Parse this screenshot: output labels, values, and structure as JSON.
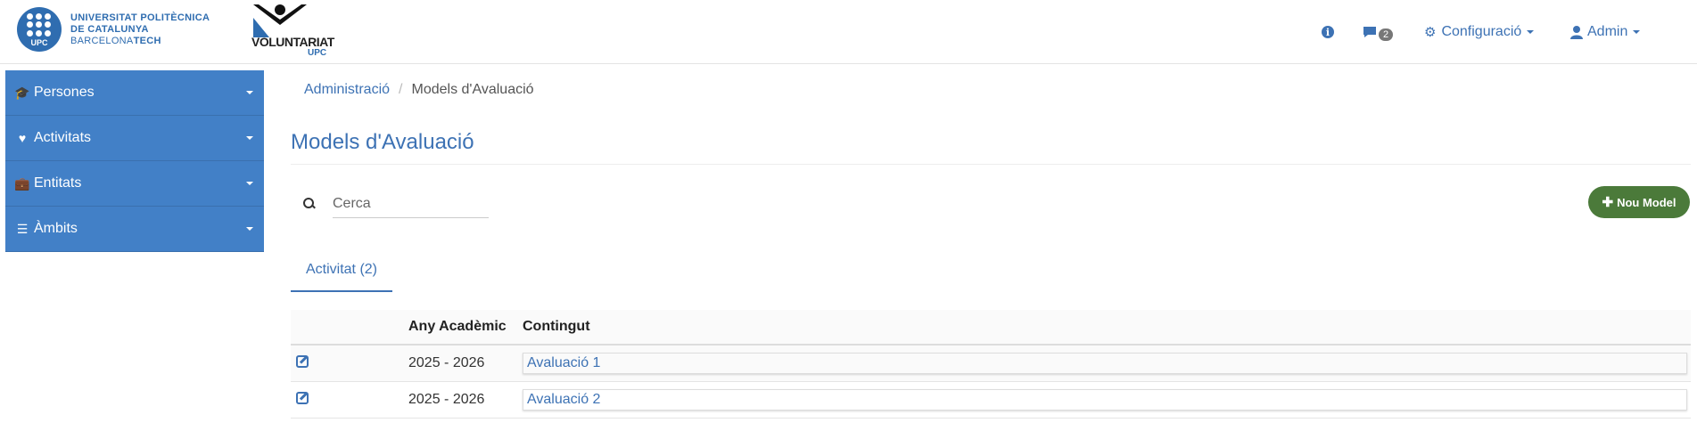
{
  "header": {
    "upc_logo": {
      "circle_text": "UPC",
      "line1": "UNIVERSITAT POLITÈCNICA",
      "line2": "DE CATALUNYA",
      "line3_light": "BARCELONA",
      "line3_bold": "TECH"
    },
    "voluntariat_logo": {
      "title": "VOLUNTARIAT",
      "subtitle": "UPC"
    },
    "info_icon": "i",
    "messages_count": "2",
    "config_label": "Configuració",
    "admin_label": "Admin"
  },
  "sidebar": {
    "items": [
      {
        "label": "Persones",
        "icon": "graduation-cap-icon",
        "glyph": "🎓"
      },
      {
        "label": "Activitats",
        "icon": "heart-icon",
        "glyph": "♥"
      },
      {
        "label": "Entitats",
        "icon": "briefcase-icon",
        "glyph": "💼"
      },
      {
        "label": "Àmbits",
        "icon": "list-icon",
        "glyph": "☰"
      }
    ]
  },
  "breadcrumb": {
    "parent": "Administració",
    "separator": "/",
    "current": "Models d'Avaluació"
  },
  "page_title": "Models d'Avaluació",
  "search": {
    "placeholder": "Cerca",
    "value": ""
  },
  "new_button_label": "Nou Model",
  "tabs": [
    {
      "label": "Activitat (2)",
      "active": true
    }
  ],
  "table": {
    "headers": [
      "",
      "Any Acadèmic",
      "Contingut"
    ],
    "rows": [
      {
        "year": "2025 - 2026",
        "content": "Avaluació 1"
      },
      {
        "year": "2025 - 2026",
        "content": "Avaluació 2"
      }
    ]
  },
  "colors": {
    "primary": "#3d72b4",
    "sidebar": "#4280c7",
    "new_button": "#4b7a3a"
  }
}
